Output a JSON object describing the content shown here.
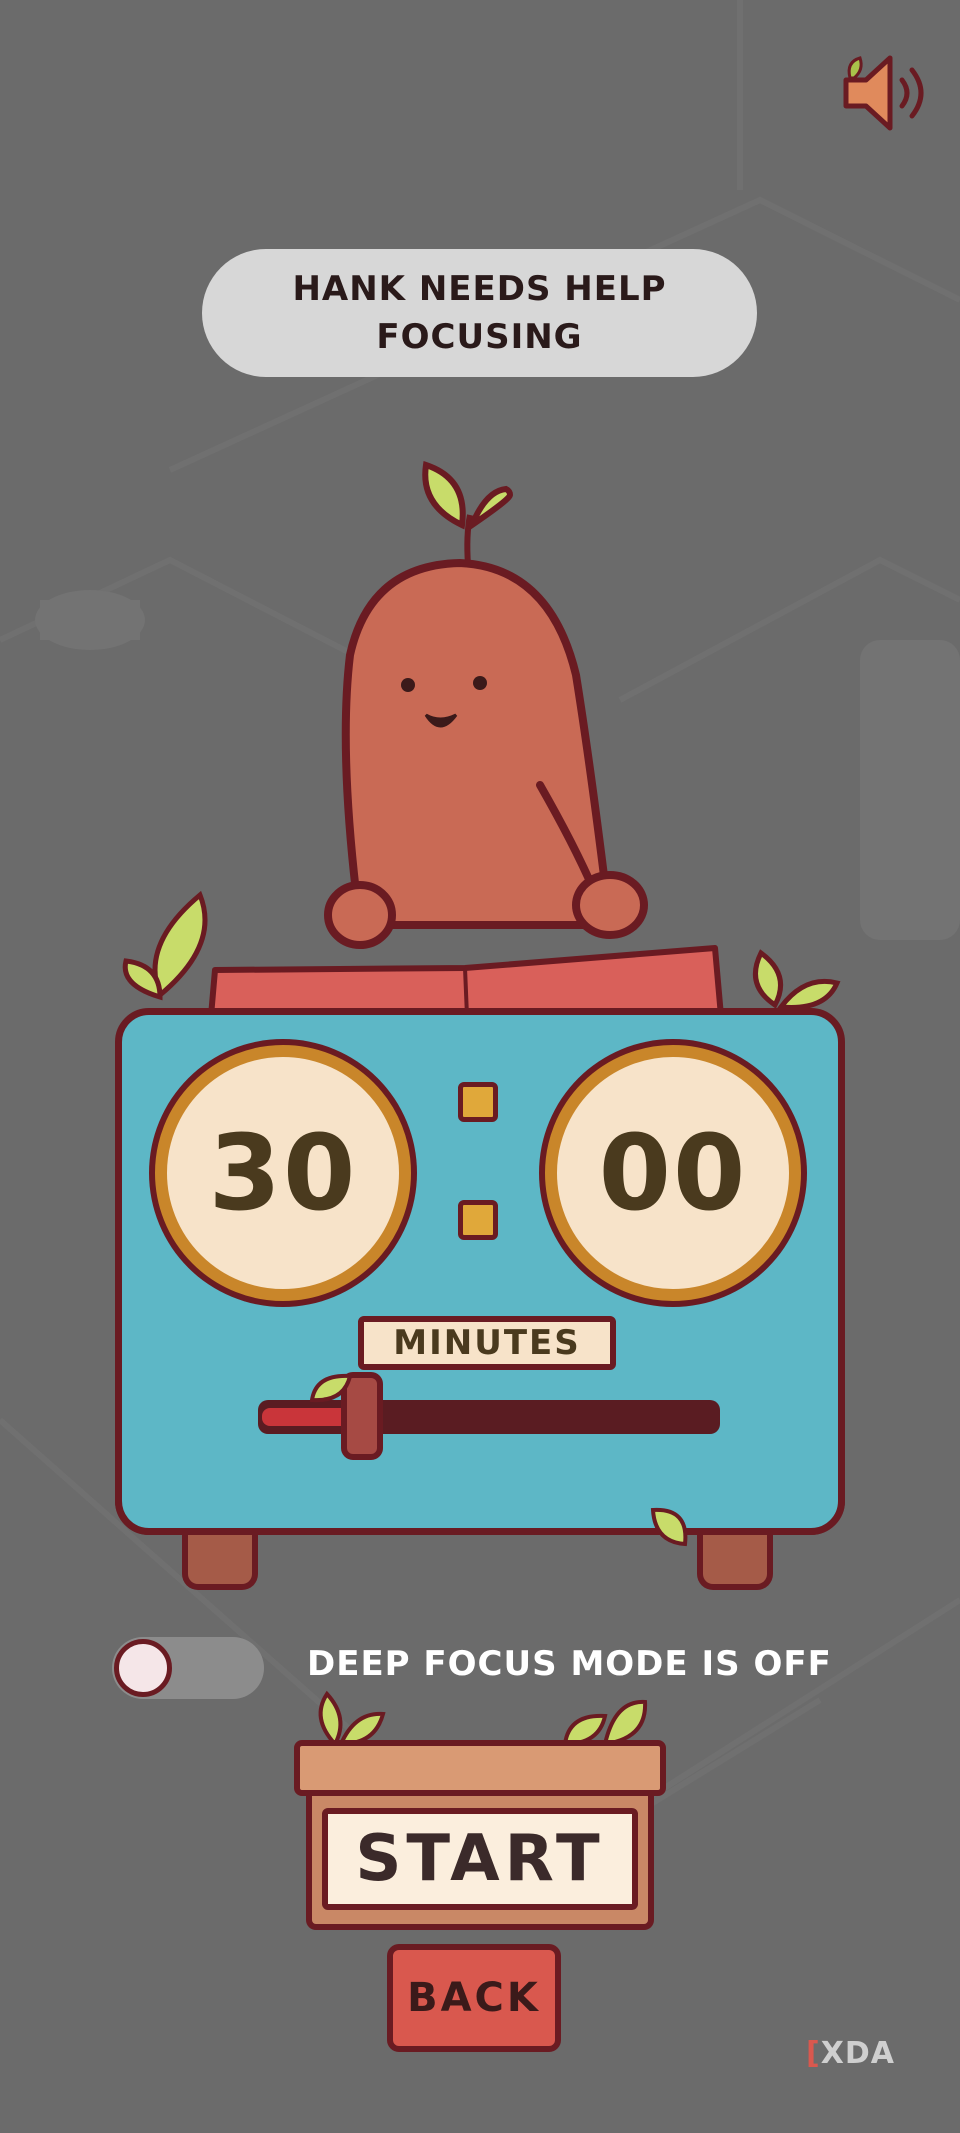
{
  "header": {
    "speech_line1": "HANK NEEDS HELP",
    "speech_line2": "FOCUSING",
    "sound_icon": "speaker-icon"
  },
  "timer": {
    "minutes_display": "30",
    "seconds_display": "00",
    "unit_label": "MINUTES",
    "slider_value_fraction": 0.22
  },
  "deep_focus": {
    "toggle_on": false,
    "label": "DEEP FOCUS MODE IS OFF"
  },
  "actions": {
    "start_label": "START",
    "back_label": "BACK"
  },
  "watermark": {
    "text": "XDA"
  },
  "colors": {
    "background": "#6b6b6b",
    "character": "#c96a55",
    "timer_body": "#5db7c6",
    "dial_ring": "#c9862a",
    "outline": "#6a1b22",
    "back_button": "#d9584e"
  }
}
